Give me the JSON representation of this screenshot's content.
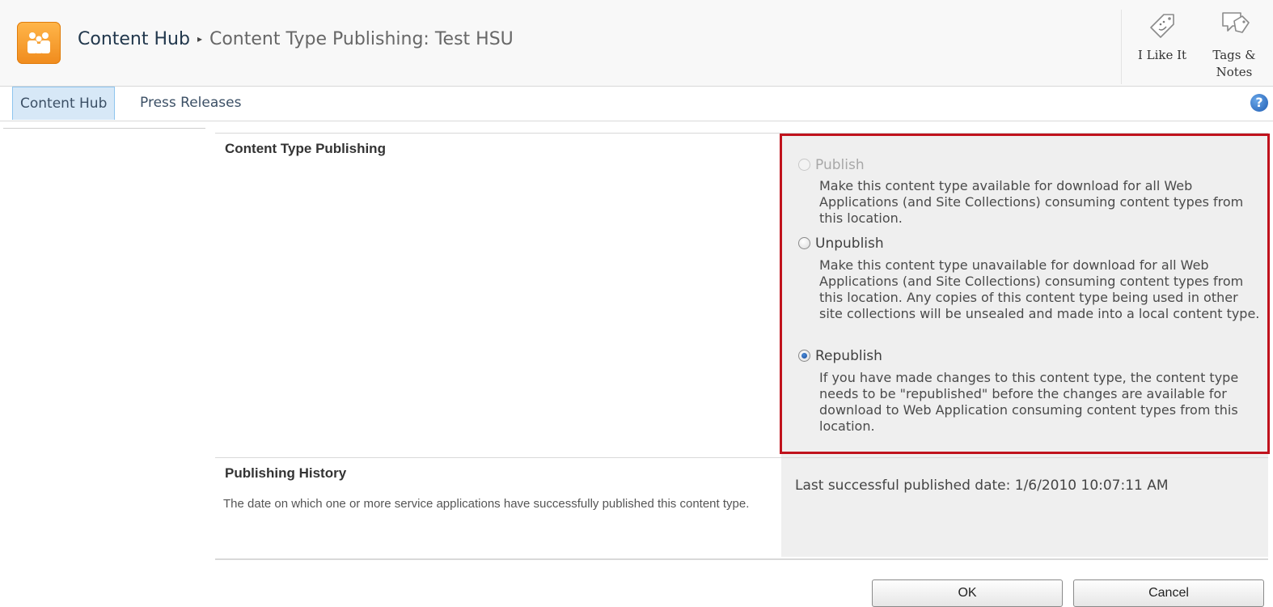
{
  "header": {
    "site_name": "Content Hub",
    "separator": "▸",
    "page_title": "Content Type Publishing: Test HSU",
    "social": [
      {
        "label": "I Like It",
        "icon": "tag-smiley-icon"
      },
      {
        "label": "Tags & Notes",
        "icon": "tags-notes-icon"
      }
    ]
  },
  "topnav": {
    "items": [
      {
        "label": "Content Hub",
        "selected": true
      },
      {
        "label": "Press Releases",
        "selected": false
      }
    ],
    "help_icon": "?"
  },
  "publishing_section": {
    "title": "Content Type Publishing",
    "options": [
      {
        "label": "Publish",
        "state": "disabled",
        "description": "Make this content type available for download for all Web Applications (and Site Collections) consuming content types from this location."
      },
      {
        "label": "Unpublish",
        "state": "unchecked",
        "description": "Make this content type unavailable for download for all Web Applications (and Site Collections) consuming content types from this location. Any copies of this content type being used in other site collections will be unsealed and made into a local content type."
      },
      {
        "label": "Republish",
        "state": "checked",
        "description": "If you have made changes to this content type, the content type needs to be \"republished\" before the changes are available for download to Web Application consuming content types from this location."
      }
    ]
  },
  "history_section": {
    "title": "Publishing History",
    "description": "The date on which one or more service applications have successfully published this content type.",
    "last_published": "Last successful published date: 1/6/2010 10:07:11 AM"
  },
  "buttons": {
    "ok": "OK",
    "cancel": "Cancel"
  },
  "colors": {
    "highlight_border": "#c0121c",
    "selected_tab_bg": "#d7e8f7",
    "control_bg": "#efefef",
    "logo_orange": "#f39a26"
  }
}
